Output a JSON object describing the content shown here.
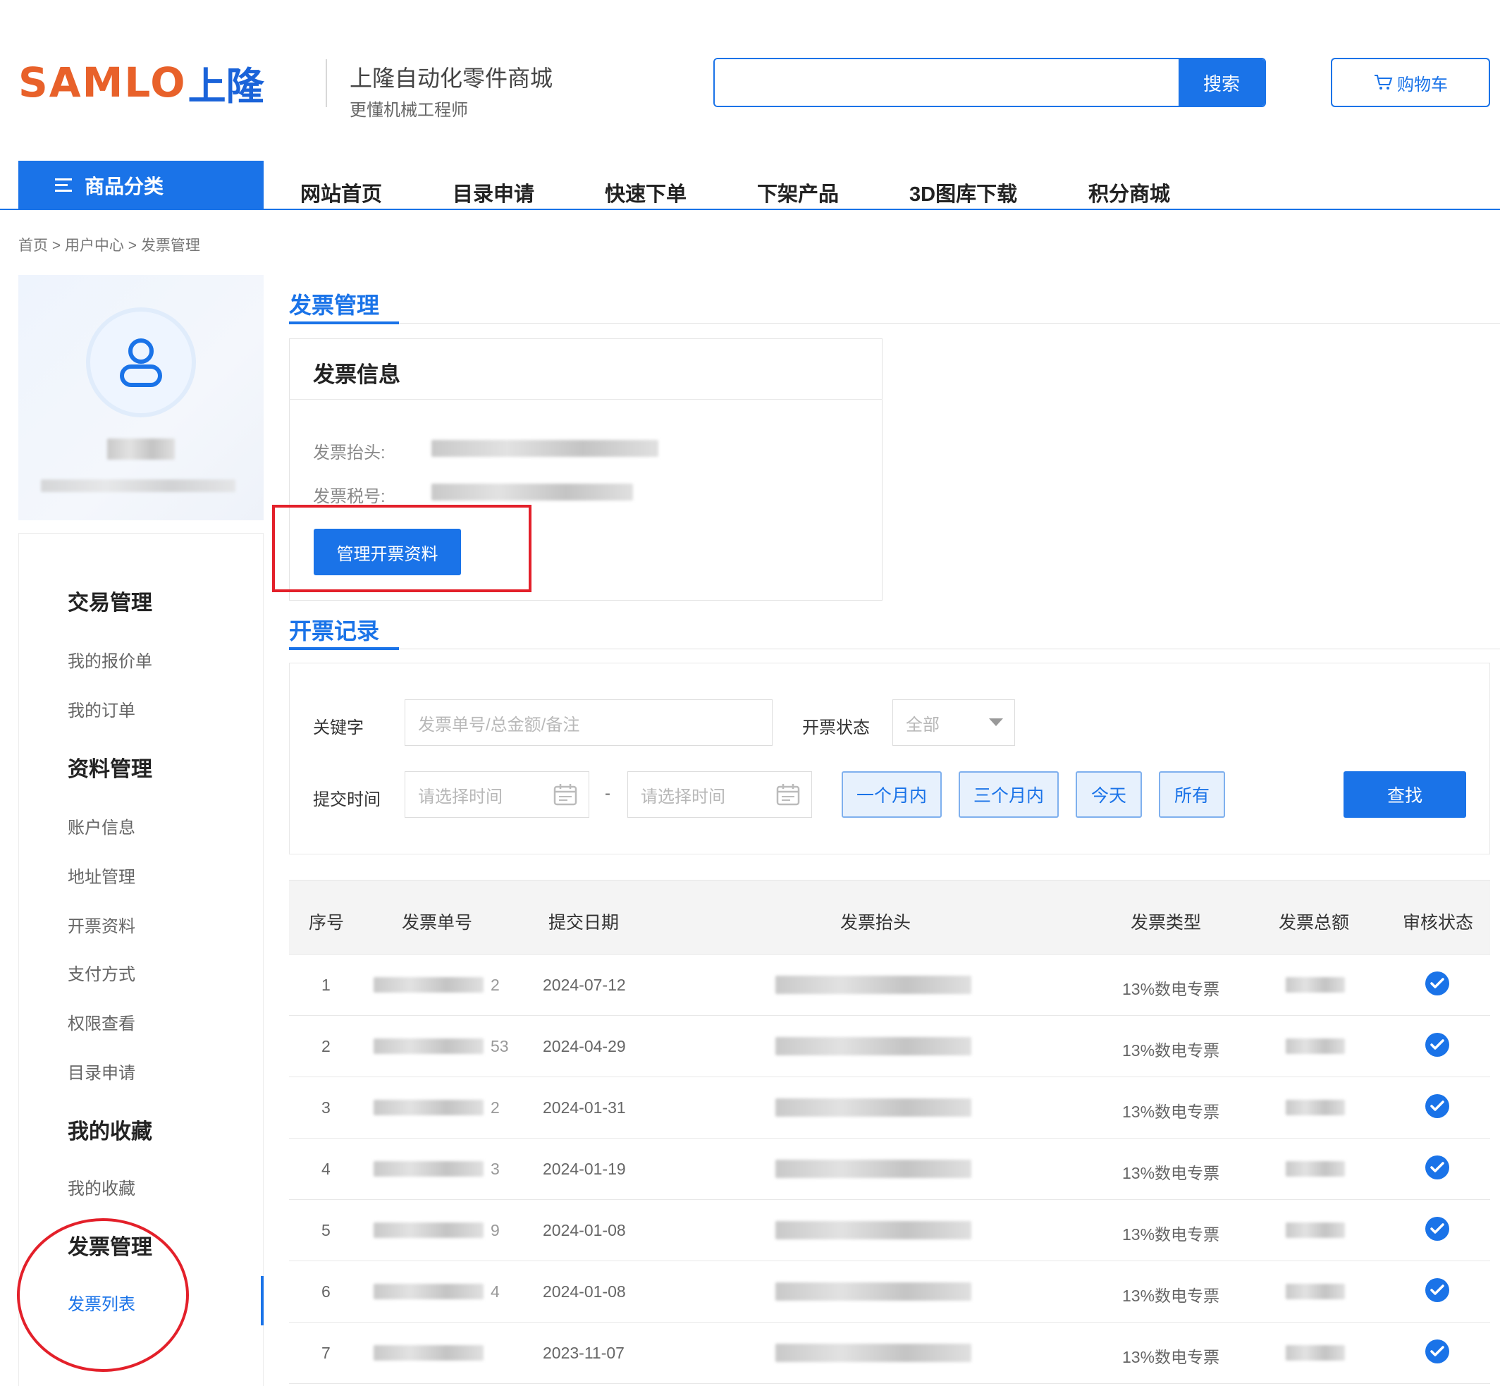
{
  "header": {
    "logo_latin": "SAMLO",
    "logo_cn": "上隆",
    "site_title": "上隆自动化零件商城",
    "site_slogan": "更懂机械工程师",
    "search_placeholder": "",
    "search_button": "搜索",
    "cart_label": "购物车"
  },
  "nav": {
    "category_label": "商品分类",
    "items": [
      "网站首页",
      "目录申请",
      "快速下单",
      "下架产品",
      "3D图库下载",
      "积分商城"
    ]
  },
  "breadcrumb": "首页 > 用户中心 > 发票管理",
  "sidebar": {
    "groups": [
      {
        "title": "交易管理",
        "items": [
          "我的报价单",
          "我的订单"
        ]
      },
      {
        "title": "资料管理",
        "items": [
          "账户信息",
          "地址管理",
          "开票资料",
          "支付方式",
          "权限查看",
          "目录申请"
        ]
      },
      {
        "title": "我的收藏",
        "items": [
          "我的收藏"
        ]
      },
      {
        "title": "发票管理",
        "items": [
          "发票列表"
        ]
      }
    ],
    "active_item": "发票列表"
  },
  "invoice_section": {
    "title": "发票管理",
    "card_title": "发票信息",
    "header_label": "发票抬头:",
    "tax_label": "发票税号:",
    "manage_button": "管理开票资料"
  },
  "records_section": {
    "title": "开票记录",
    "keyword_label": "关键字",
    "keyword_placeholder": "发票单号/总金额/备注",
    "status_label": "开票状态",
    "status_value": "全部",
    "time_label": "提交时间",
    "time_placeholder": "请选择时间",
    "time_separator": "-",
    "quick_buttons": [
      "一个月内",
      "三个月内",
      "今天",
      "所有"
    ],
    "find_button": "查找"
  },
  "table": {
    "columns": [
      "序号",
      "发票单号",
      "提交日期",
      "发票抬头",
      "发票类型",
      "发票总额",
      "审核状态"
    ],
    "rows": [
      {
        "index": "1",
        "no_tail": "2",
        "date": "2024-07-12",
        "type": "13%数电专票",
        "status": "approved"
      },
      {
        "index": "2",
        "no_tail": "53",
        "date": "2024-04-29",
        "type": "13%数电专票",
        "status": "approved"
      },
      {
        "index": "3",
        "no_tail": "2",
        "date": "2024-01-31",
        "type": "13%数电专票",
        "status": "approved"
      },
      {
        "index": "4",
        "no_tail": "3",
        "date": "2024-01-19",
        "type": "13%数电专票",
        "status": "approved"
      },
      {
        "index": "5",
        "no_tail": "9",
        "date": "2024-01-08",
        "type": "13%数电专票",
        "status": "approved"
      },
      {
        "index": "6",
        "no_tail": "4",
        "date": "2024-01-08",
        "type": "13%数电专票",
        "status": "approved"
      },
      {
        "index": "7",
        "no_tail": "",
        "date": "2023-11-07",
        "type": "13%数电专票",
        "status": "approved"
      }
    ]
  },
  "colors": {
    "primary": "#1a73e8",
    "logo_orange": "#e8612a",
    "annotation_red": "#e3202a"
  },
  "icons": {
    "cart": "cart-icon",
    "menu": "hamburger-icon",
    "user": "user-icon",
    "calendar": "calendar-icon",
    "dropdown": "caret-down-icon",
    "check": "check-circle-icon"
  }
}
